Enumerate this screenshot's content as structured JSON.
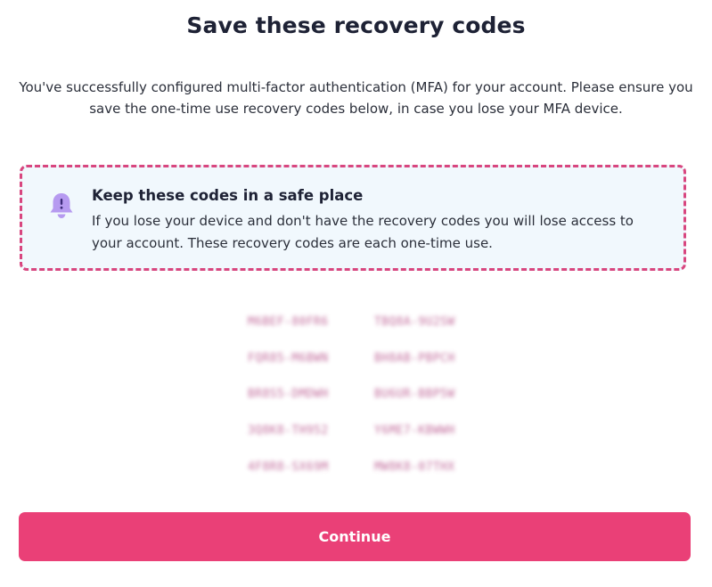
{
  "page": {
    "title": "Save these recovery codes",
    "intro": "You've successfully configured multi-factor authentication (MFA) for your account. Please ensure you save the one-time use recovery codes below, in case you lose your MFA device."
  },
  "notice": {
    "icon": "bell-icon",
    "title": "Keep these codes in a safe place",
    "body": "If you lose your device and don't have the recovery codes you will lose access to your account. These recovery codes are each one-time use.",
    "border_color": "#d8467f",
    "background": "#f1f8fd",
    "icon_color": "#b69af0"
  },
  "recovery_codes": [
    "M6BEF-80FR6",
    "TBQ8A-9U2SW",
    "FQR85-M6BWN",
    "BH8AB-PBPCH",
    "BR8S5-DMDWH",
    "BU6UR-BBP5W",
    "3Q8K8-TH952",
    "Y6ME7-KBWWH",
    "4F8R8-SX69M",
    "MW8K8-07THX"
  ],
  "actions": {
    "continue_label": "Continue"
  },
  "colors": {
    "accent": "#ea4077",
    "heading": "#1e2235",
    "code_text": "#b0407e"
  }
}
